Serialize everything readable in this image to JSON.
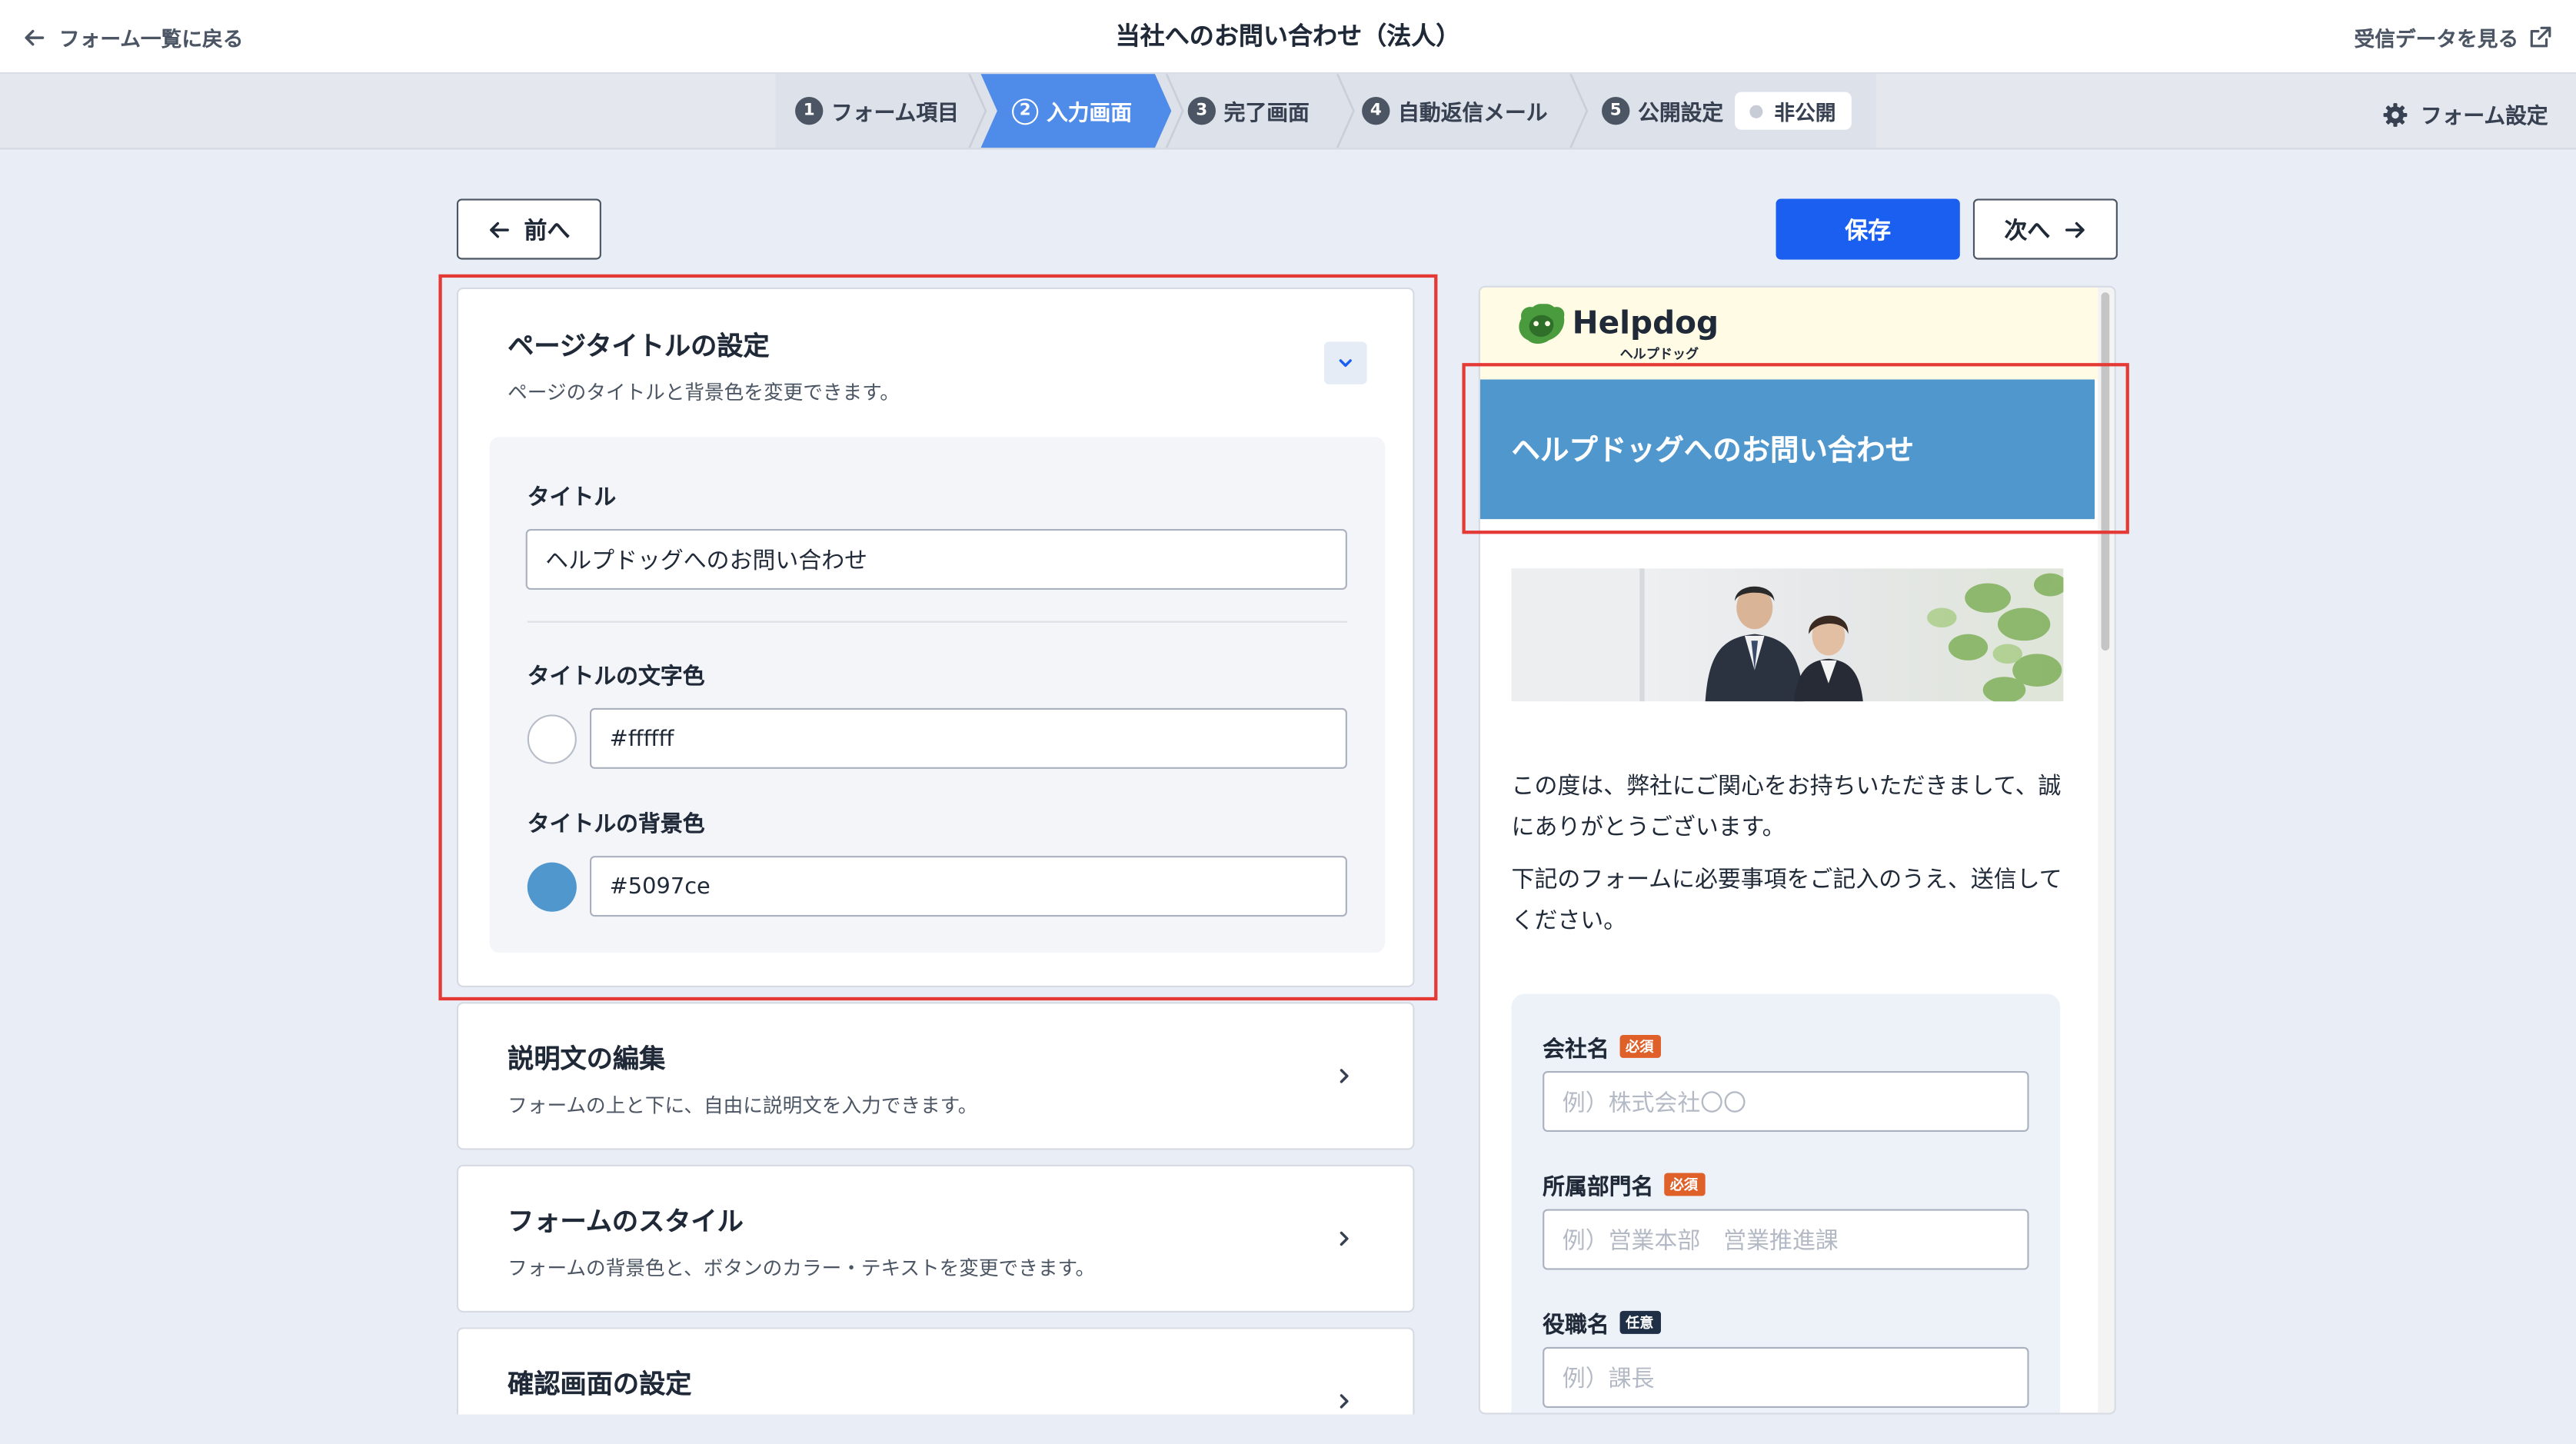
{
  "topbar": {
    "back_label": "フォーム一覧に戻る",
    "title": "当社へのお問い合わせ（法人）",
    "responses_link": "受信データを見る"
  },
  "steps": [
    {
      "num": "1",
      "label": "フォーム項目"
    },
    {
      "num": "2",
      "label": "入力画面"
    },
    {
      "num": "3",
      "label": "完了画面"
    },
    {
      "num": "4",
      "label": "自動返信メール"
    },
    {
      "num": "5",
      "label": "公開設定"
    }
  ],
  "active_step": "2",
  "publish_status": "非公開",
  "form_settings_label": "フォーム設定",
  "actions": {
    "prev": "前へ",
    "save": "保存",
    "next": "次へ"
  },
  "page_title_card": {
    "title": "ページタイトルの設定",
    "description": "ページのタイトルと背景色を変更できます。",
    "title_label": "タイトル",
    "title_value": "ヘルプドッグへのお問い合わせ",
    "text_color_label": "タイトルの文字色",
    "text_color_value": "#ffffff",
    "bg_color_label": "タイトルの背景色",
    "bg_color_value": "#5097ce"
  },
  "cards": [
    {
      "title": "説明文の編集",
      "description": "フォームの上と下に、自由に説明文を入力できます。"
    },
    {
      "title": "フォームのスタイル",
      "description": "フォームの背景色と、ボタンのカラー・テキストを変更できます。"
    },
    {
      "title": "確認画面の設定",
      "description": ""
    }
  ],
  "preview": {
    "logo_text": "Helpdog",
    "logo_sub": "ヘルプドッグ",
    "banner_title": "ヘルプドッグへのお問い合わせ",
    "intro_1": "この度は、弊社にご関心をお持ちいただきまして、誠にありがとうございます。",
    "intro_2": "下記のフォームに必要事項をご記入のうえ、送信してください。",
    "fields": [
      {
        "label": "会社名",
        "tag": "必須",
        "placeholder": "例）株式会社〇〇"
      },
      {
        "label": "所属部門名",
        "tag": "必須",
        "placeholder": "例）営業本部　営業推進課"
      },
      {
        "label": "役職名",
        "tag": "任意",
        "placeholder": "例）課長"
      }
    ]
  },
  "colors": {
    "accent": "#1a5ff0",
    "active_step": "#4f8be8",
    "highlight": "#e53935",
    "logo_green": "#4a9a3e"
  }
}
